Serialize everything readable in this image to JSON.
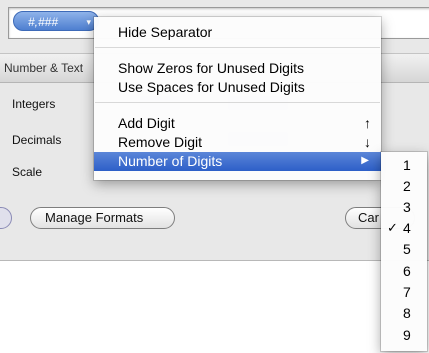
{
  "format_field": {
    "token_label": "#,###",
    "token_chevron": "▾"
  },
  "panel": {
    "section_title": "Number & Text",
    "rows": [
      "Integers",
      "Decimals",
      "Scale"
    ],
    "buttons": {
      "manage_formats": "Manage Formats",
      "cancel_partial": "Car"
    }
  },
  "menu": {
    "items": [
      {
        "label": "Hide Separator"
      },
      {
        "label": "Show Zeros for Unused Digits"
      },
      {
        "label": "Use Spaces for Unused Digits"
      },
      {
        "label": "Add Digit",
        "shortcut": "↑"
      },
      {
        "label": "Remove Digit",
        "shortcut": "↓"
      },
      {
        "label": "Number of Digits",
        "submenu_arrow": "▶",
        "highlighted": true
      }
    ]
  },
  "submenu": {
    "items": [
      "1",
      "2",
      "3",
      "4",
      "5",
      "6",
      "7",
      "8",
      "9"
    ],
    "checked": "4",
    "check_mark": "✓"
  },
  "colors": {
    "highlight": "#3a6bd0",
    "token": "#5b8ad8"
  }
}
